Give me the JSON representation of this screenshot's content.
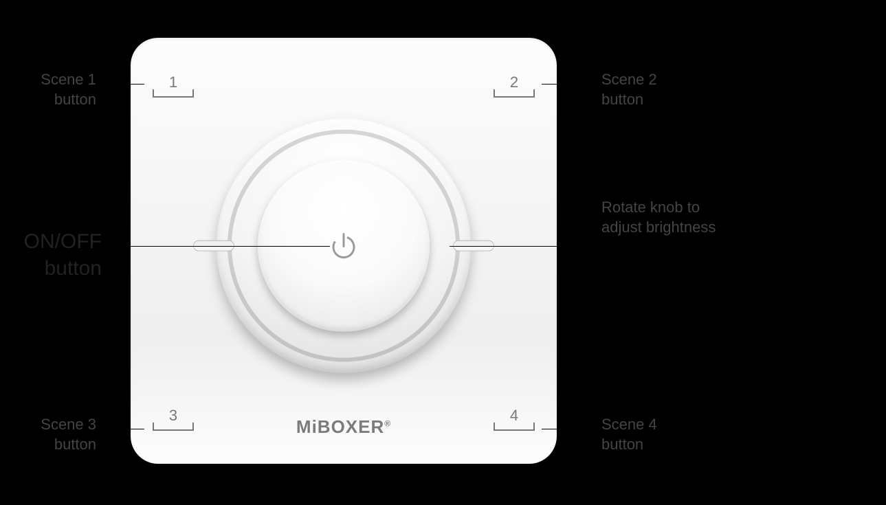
{
  "labels": {
    "scene1": "Scene 1\nbutton",
    "scene2": "Scene 2\nbutton",
    "scene3": "Scene 3\nbutton",
    "scene4": "Scene 4\nbutton",
    "on_off": "ON/OFF\nbutton",
    "knob": "Rotate knob to\nadjust brightness"
  },
  "scenes": {
    "s1": "1",
    "s2": "2",
    "s3": "3",
    "s4": "4"
  },
  "brand": {
    "name": "MiBOXER",
    "reg": "®"
  }
}
